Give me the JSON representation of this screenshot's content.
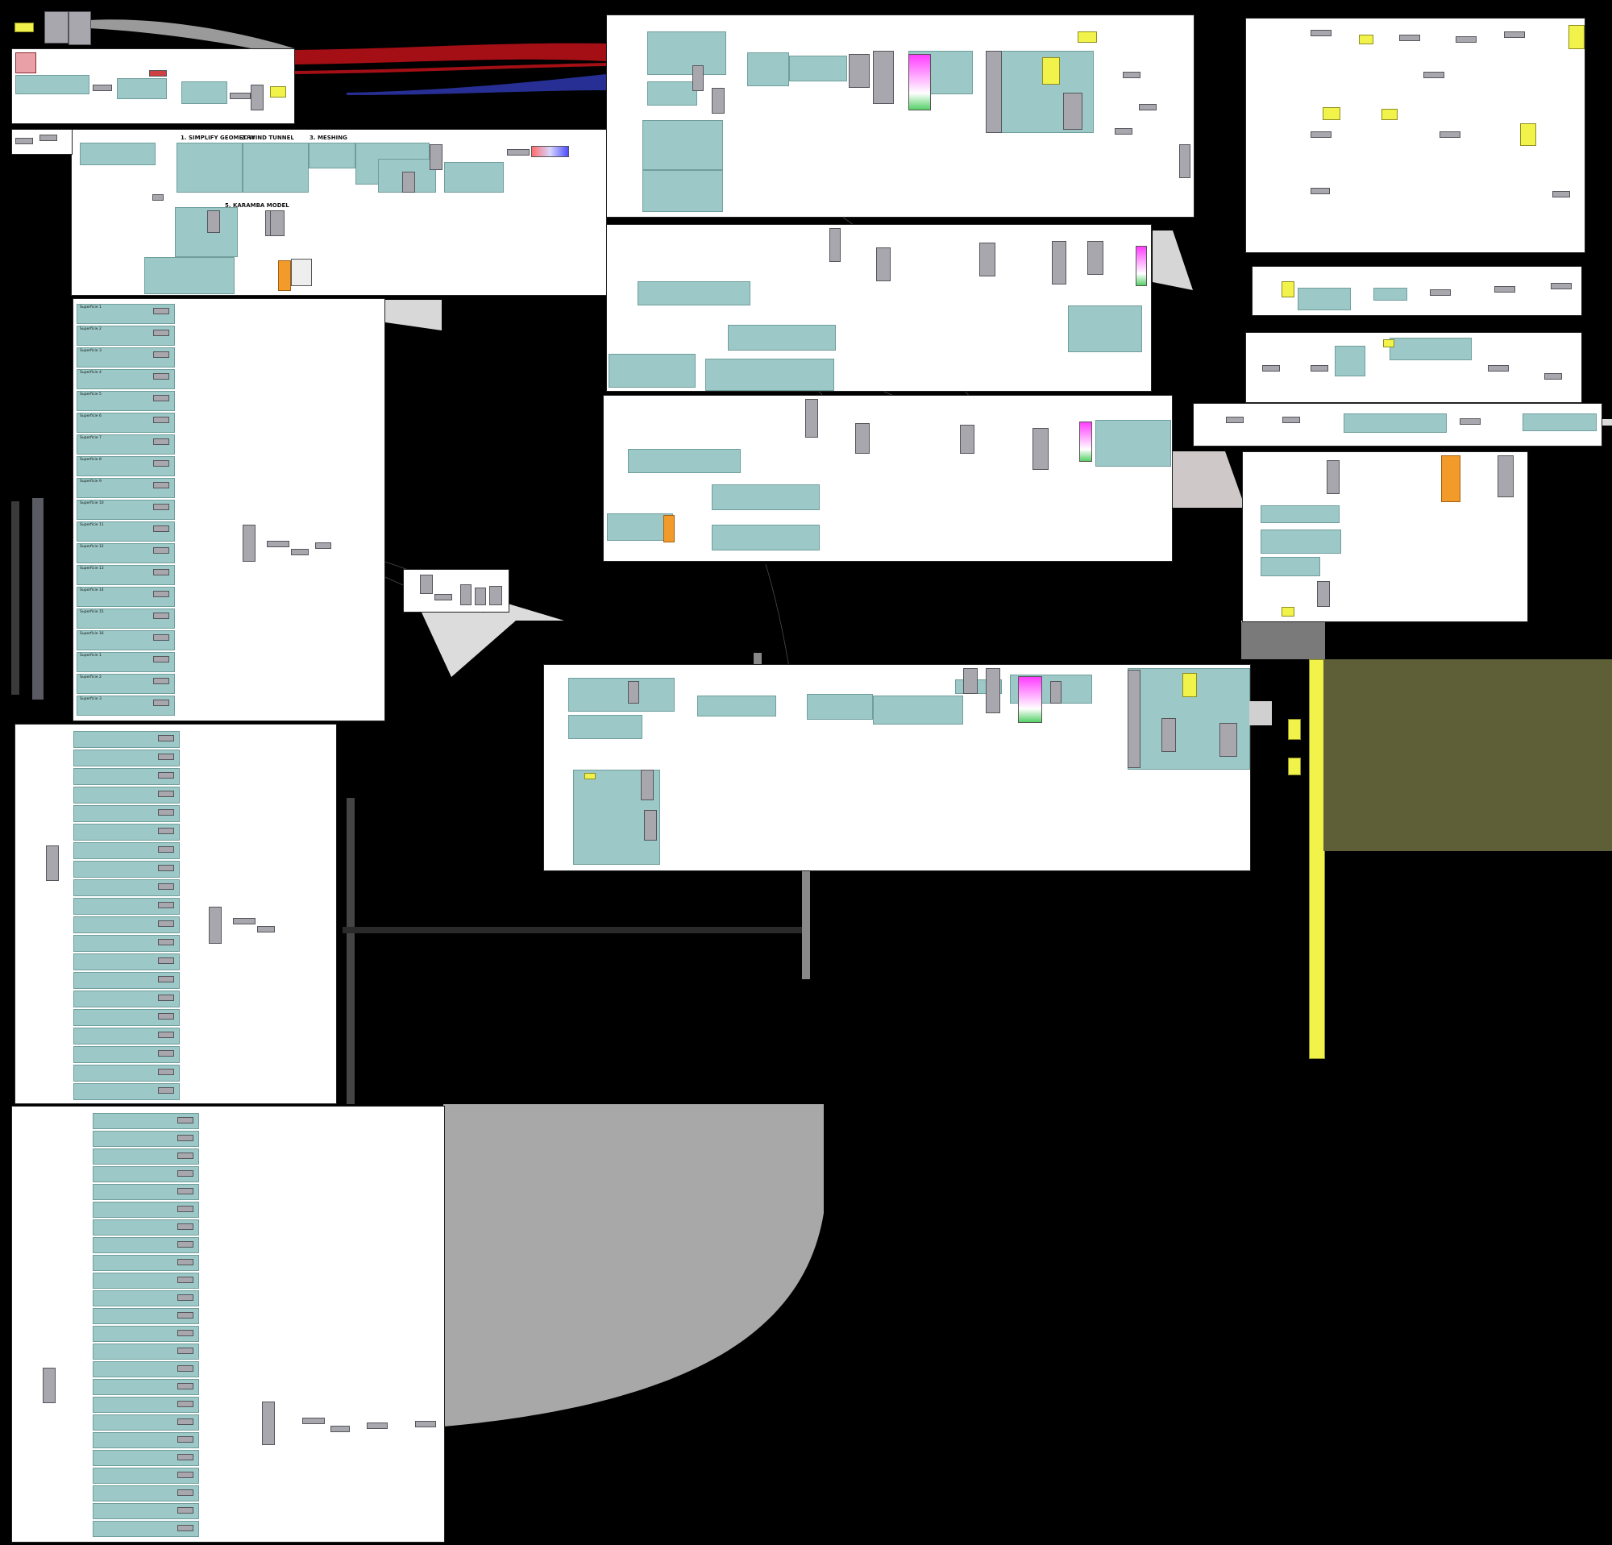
{
  "canvas": {
    "background": "#000000",
    "panel_color": "#ffffff",
    "group_color": "#9cc9c7",
    "node_color": "#a7a7ad",
    "note_color": "#f1f24a",
    "orange_color": "#f39b2a",
    "wire_color": "#555555"
  },
  "titles": {
    "simplify": "1. SIMPLIFY GEOMETRY",
    "wind": "2. WIND TUNNEL",
    "meshing": "3. MESHING",
    "karamba": "5. KARAMBA MODEL"
  },
  "superficie_labels": [
    "Superficie 1",
    "Superficie 2",
    "Superficie 3",
    "Superficie 4",
    "Superficie 5",
    "Superficie 6",
    "Superficie 7",
    "Superficie 8",
    "Superficie 9",
    "Superficie 10",
    "Superficie 11",
    "Superficie 12",
    "Superficie 13",
    "Superficie 14",
    "Superficie 15",
    "Superficie 16"
  ]
}
